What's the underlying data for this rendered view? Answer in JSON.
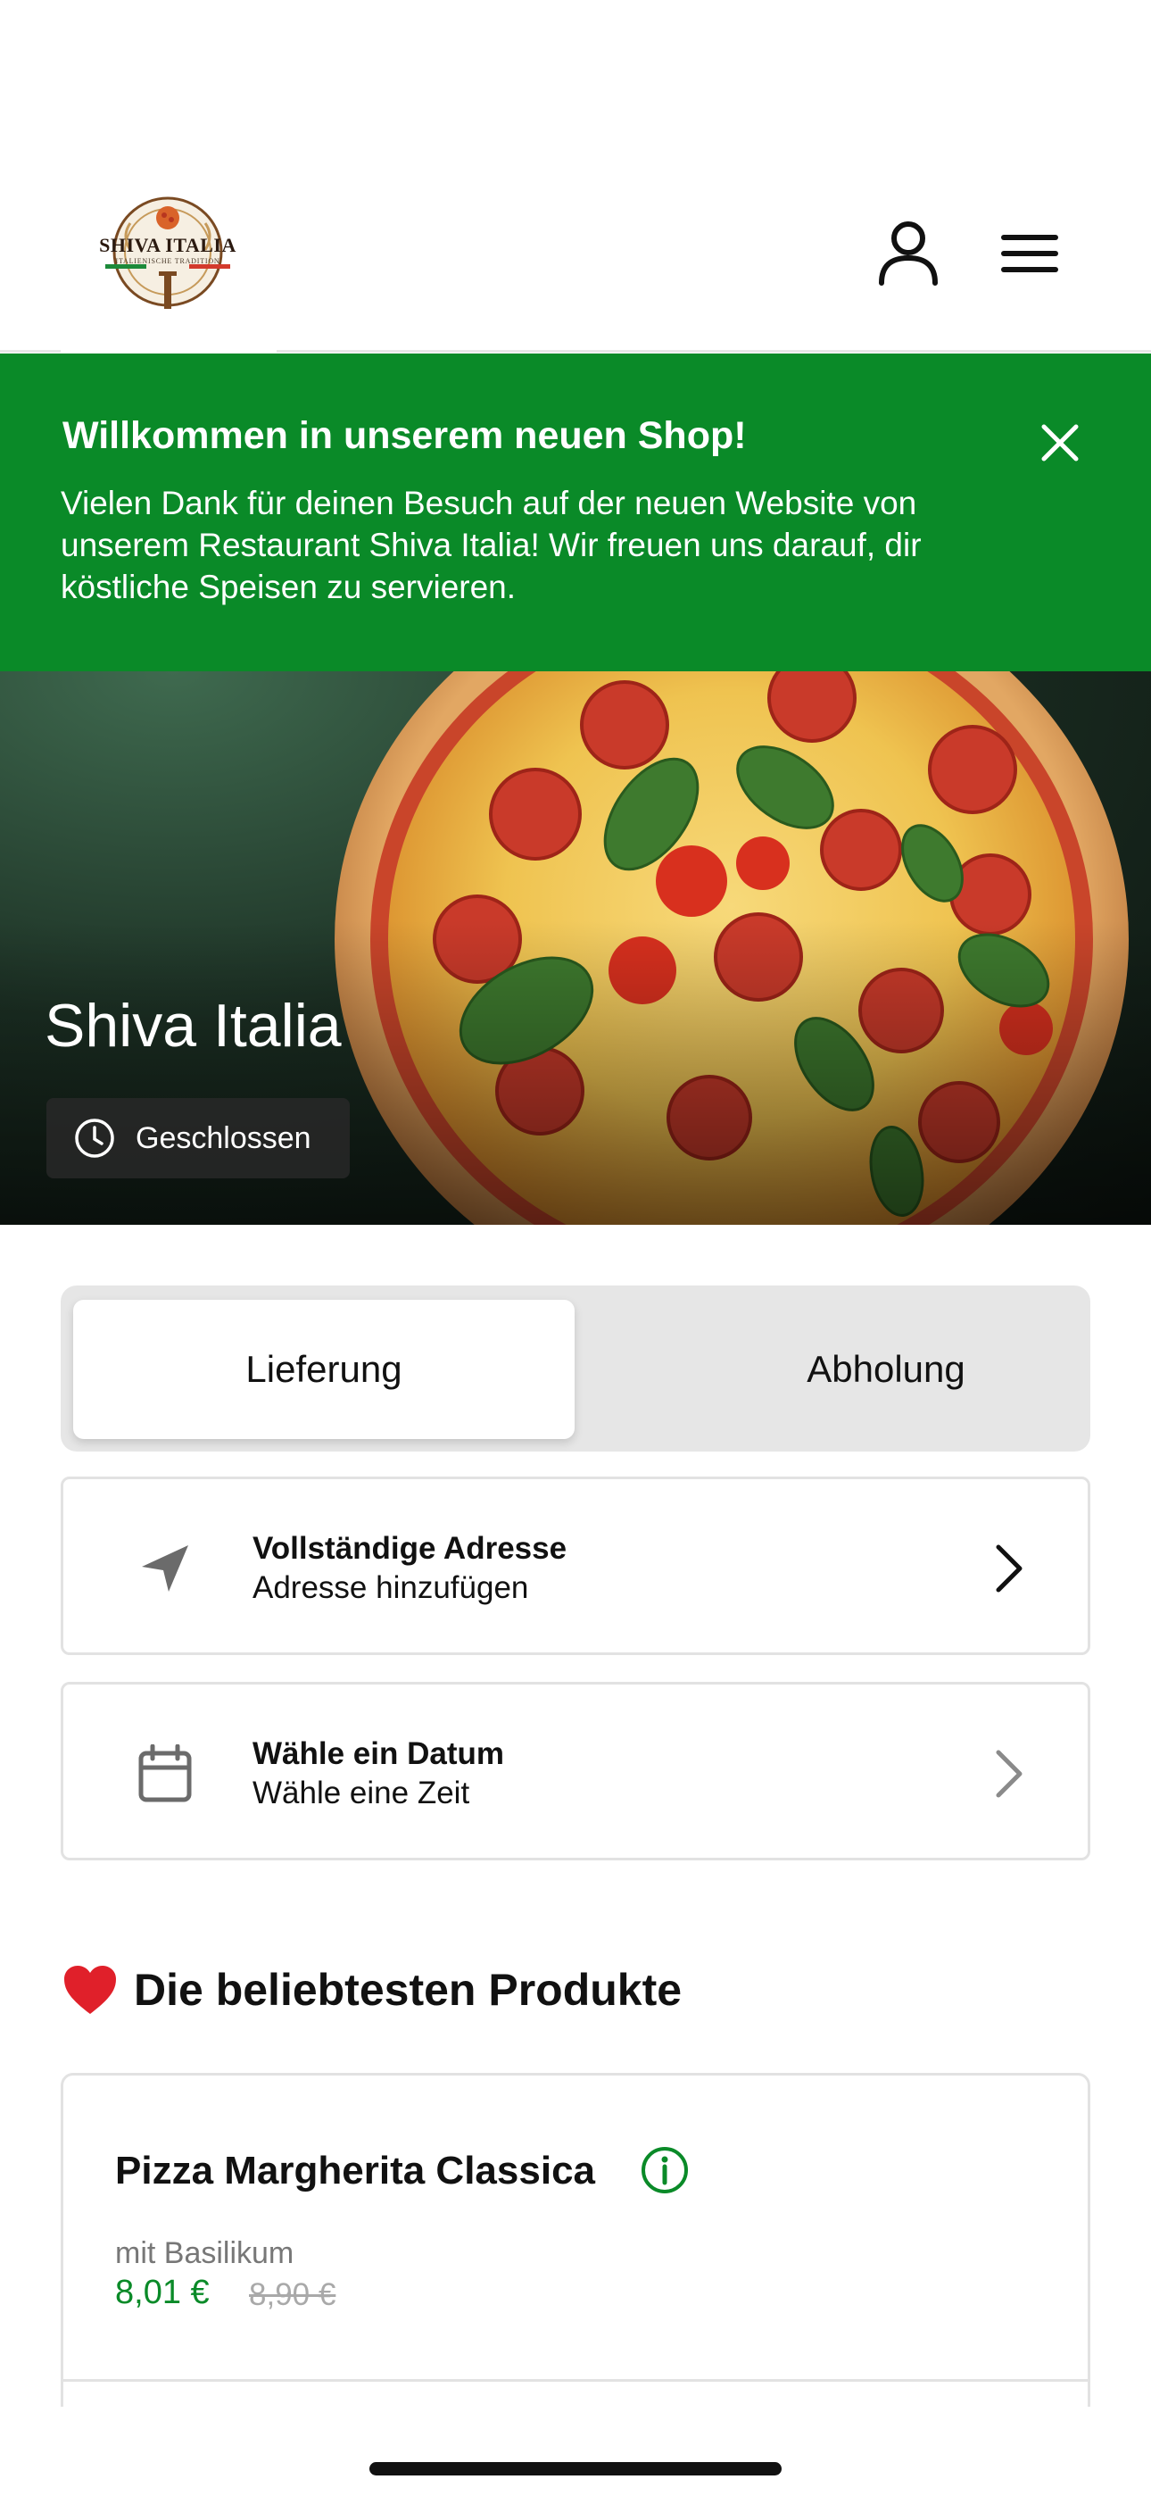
{
  "header": {
    "logo_name": "SHIVA ITALIA",
    "logo_tagline": "ITALIENISCHE TRADITION",
    "user_icon": "user-icon",
    "menu_icon": "menu-icon"
  },
  "banner": {
    "title": "Willkommen in unserem neuen Shop!",
    "text": "Vielen Dank für deinen Besuch auf der neuen Website von unserem Restaurant Shiva Italia! Wir freuen uns darauf, dir köstliche Speisen zu servieren.",
    "close_icon": "close-icon",
    "color": "#0a8a28"
  },
  "hero": {
    "title": "Shiva Italia",
    "status": "Geschlossen",
    "status_icon": "clock-icon"
  },
  "order_mode": {
    "options": [
      "Lieferung",
      "Abholung"
    ],
    "selected": "Lieferung"
  },
  "address": {
    "title": "Vollständige Adresse",
    "subtitle": "Adresse hinzufügen",
    "icon": "location-arrow-icon"
  },
  "schedule": {
    "title": "Wähle ein Datum",
    "subtitle": "Wähle eine Zeit",
    "icon": "calendar-icon"
  },
  "popular": {
    "title": "Die beliebtesten Produkte",
    "icon": "heart-icon",
    "products": [
      {
        "name": "Pizza Margherita Classica",
        "description": "mit Basilikum",
        "price": "8,01 €",
        "old_price": "8,90 €"
      }
    ]
  },
  "colors": {
    "accent": "#0a8a28",
    "text": "#111111",
    "muted": "#777777"
  }
}
